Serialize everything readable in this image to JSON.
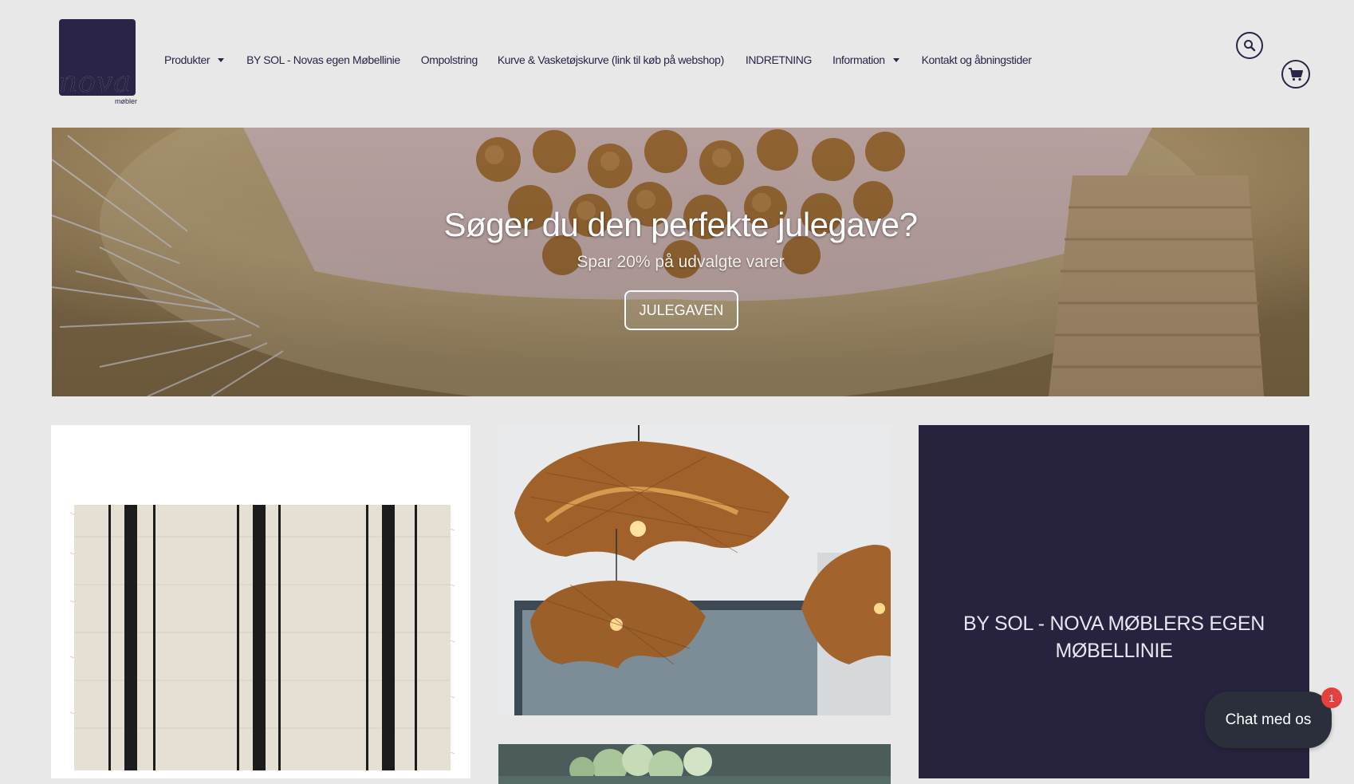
{
  "brand": {
    "logo_name": "nova",
    "logo_sub": "møbler"
  },
  "nav": {
    "items": [
      {
        "label": "Produkter",
        "has_dropdown": true
      },
      {
        "label": "BY SOL - Novas egen Møbellinie",
        "has_dropdown": false
      },
      {
        "label": "Ompolstring",
        "has_dropdown": false
      },
      {
        "label": "Kurve & Vasketøjskurve (link til køb på webshop)",
        "has_dropdown": false
      },
      {
        "label": "INDRETNING",
        "has_dropdown": false
      },
      {
        "label": "Information",
        "has_dropdown": true
      },
      {
        "label": "Kontakt og åbningstider",
        "has_dropdown": false
      }
    ]
  },
  "header_icons": {
    "search": "search-icon",
    "cart": "cart-icon"
  },
  "hero": {
    "title": "Søger du den perfekte julegave?",
    "subtitle": "Spar 20% på udvalgte varer",
    "button_label": "JULEGAVEN"
  },
  "tiles": {
    "brand_text": "BY SOL - NOVA MØBLERS EGEN MØBELLINIE"
  },
  "chat": {
    "label": "Chat med os",
    "badge_count": "1"
  },
  "colors": {
    "brand": "#27233f",
    "background": "#e8e8e8",
    "badge": "#e2413d"
  }
}
